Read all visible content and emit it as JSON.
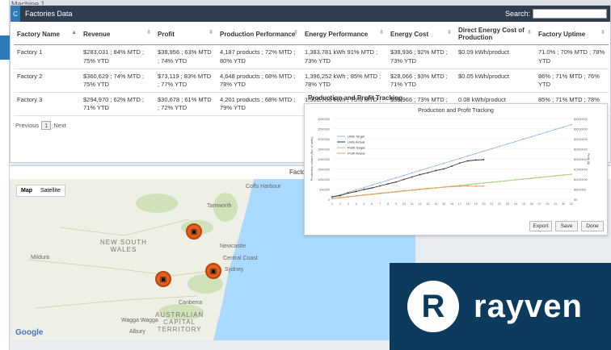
{
  "background": {
    "top_text": "Machine 1"
  },
  "panel": {
    "title": "Factories Data",
    "logo_letter": "C",
    "search_label": "Search:",
    "search_value": ""
  },
  "table": {
    "columns": [
      "Factory Name",
      "Revenue",
      "Profit",
      "Production Performance",
      "Energy Performance",
      "Energy Cost",
      "Direct Energy Cost of Production",
      "Factory Uptime"
    ],
    "rows": [
      [
        "Factory 1",
        "$283,031 ; 84% MTD ; 75% YTD",
        "$38,956 ; 63% MTD ; 74% YTD",
        "4,187 products ; 72% MTD ; 80% YTD",
        "1,383,781 kWh 91% MTD ; 73% YTD",
        "$38,936 ; 92% MTD ; 73% YTD",
        "$0.09 kWh/product",
        "71.0% ; 70% MTD ; 78% YTD"
      ],
      [
        "Factory 2",
        "$360,629 ; 74% MTD ; 75% YTD",
        "$73,119 ; 83% MTD ; 77% YTD",
        "4,648 products ; 68% MTD ; 78% YTD",
        "1,396,252 kWh ; 85% MTD ; 78% YTD",
        "$28,066 ; 93% MTD ; 71% YTD",
        "$0.05 kWh/product",
        "86% ; 71% MTD ; 76% YTD"
      ],
      [
        "Factory 3",
        "$294,970 ; 62% MTD ; 71% YTD",
        "$30,678 ; 61% MTD ; 72% YTD",
        "4,201 products ; 68% MTD ; 79% YTD",
        "1,906,706 kWh ; 75% MTD ;",
        "$38,966 ; 73% MTD ;",
        "0.08 kWh/product",
        "85% ; 71% MTD ; 78%"
      ]
    ]
  },
  "pager": {
    "previous": "Previous",
    "page": "1",
    "next": "Next"
  },
  "map_section": {
    "heading": "Factories Map"
  },
  "map": {
    "tab_map": "Map",
    "tab_satellite": "Satellite",
    "labels": {
      "nsw": "NEW SOUTH\nWALES",
      "act": "AUSTRALIAN\nCAPITAL\nTERRITORY",
      "newcastle": "Newcastle",
      "central_coast": "Central Coast",
      "sydney": "Sydney",
      "canberra": "Canberra",
      "wagga": "Wagga Wagga",
      "mildura": "Mildura",
      "tamworth": "Tamworth",
      "coffs": "Coffs Harbour",
      "albury": "Albury"
    },
    "attribution": "Google"
  },
  "chart_caption": "Production and Profit Tracking",
  "chart_data": {
    "type": "line",
    "title": "Production and Profit Tracking",
    "xlabel": "",
    "ylabel": "Production volume (No. of units)",
    "y2label": "Profit ($)",
    "ylim": [
      0,
      4000000
    ],
    "y2lim": [
      0,
      4000000
    ],
    "x": [
      1,
      2,
      3,
      4,
      5,
      6,
      7,
      8,
      9,
      10,
      11,
      12,
      13,
      14,
      15,
      16,
      17,
      18,
      19,
      20,
      21,
      22,
      23,
      24,
      25,
      26,
      27,
      28,
      29,
      30,
      31
    ],
    "yticks": [
      0,
      500000,
      1000000,
      1500000,
      2000000,
      2500000,
      3000000,
      3500000,
      4000000
    ],
    "y2ticks": [
      "$0",
      "$500000",
      "$1000000",
      "$1500000",
      "$2000000",
      "$2500000",
      "$3000000",
      "$3500000",
      "$4000000"
    ],
    "legend_placement": "left",
    "series": [
      {
        "name": "Units Target",
        "color": "#8fb4dd",
        "values": [
          100000,
          220000,
          340000,
          460000,
          580000,
          700000,
          820000,
          940000,
          1060000,
          1180000,
          1300000,
          1420000,
          1540000,
          1660000,
          1780000,
          1900000,
          2020000,
          2140000,
          2260000,
          2380000,
          2500000,
          2620000,
          2740000,
          2860000,
          2980000,
          3100000,
          3220000,
          3340000,
          3460000,
          3580000,
          3700000
        ]
      },
      {
        "name": "Units Actual",
        "color": "#333333",
        "values": [
          120000,
          180000,
          300000,
          380000,
          480000,
          560000,
          660000,
          760000,
          850000,
          980000,
          1100000,
          1220000,
          1310000,
          1420000,
          1500000,
          1640000,
          1790000,
          1900000,
          1940000,
          1960000
        ]
      },
      {
        "name": "Profit Target",
        "color": "#a7cc7b",
        "values": [
          40000,
          80000,
          120000,
          160000,
          200000,
          240000,
          280000,
          320000,
          360000,
          400000,
          440000,
          480000,
          520000,
          560000,
          600000,
          640000,
          680000,
          720000,
          760000,
          800000,
          840000,
          880000,
          920000,
          960000,
          1000000,
          1040000,
          1080000,
          1120000,
          1160000,
          1200000,
          1240000
        ]
      },
      {
        "name": "Profit Actual",
        "color": "#e0a062",
        "values": [
          30000,
          70000,
          110000,
          170000,
          210000,
          250000,
          300000,
          330000,
          380000,
          420000,
          450000,
          500000,
          540000,
          560000,
          600000,
          620000,
          640000,
          660000,
          640000,
          650000
        ]
      }
    ]
  },
  "chart_buttons": {
    "export": "Export",
    "save": "Save",
    "done": "Done"
  },
  "brand": {
    "mark": "R",
    "word": "rayven"
  },
  "colors": {
    "header": "#2f3e4f",
    "accent": "#2e7ab5",
    "brand_bg": "#0d3b5e",
    "marker": "#e45f1a"
  }
}
